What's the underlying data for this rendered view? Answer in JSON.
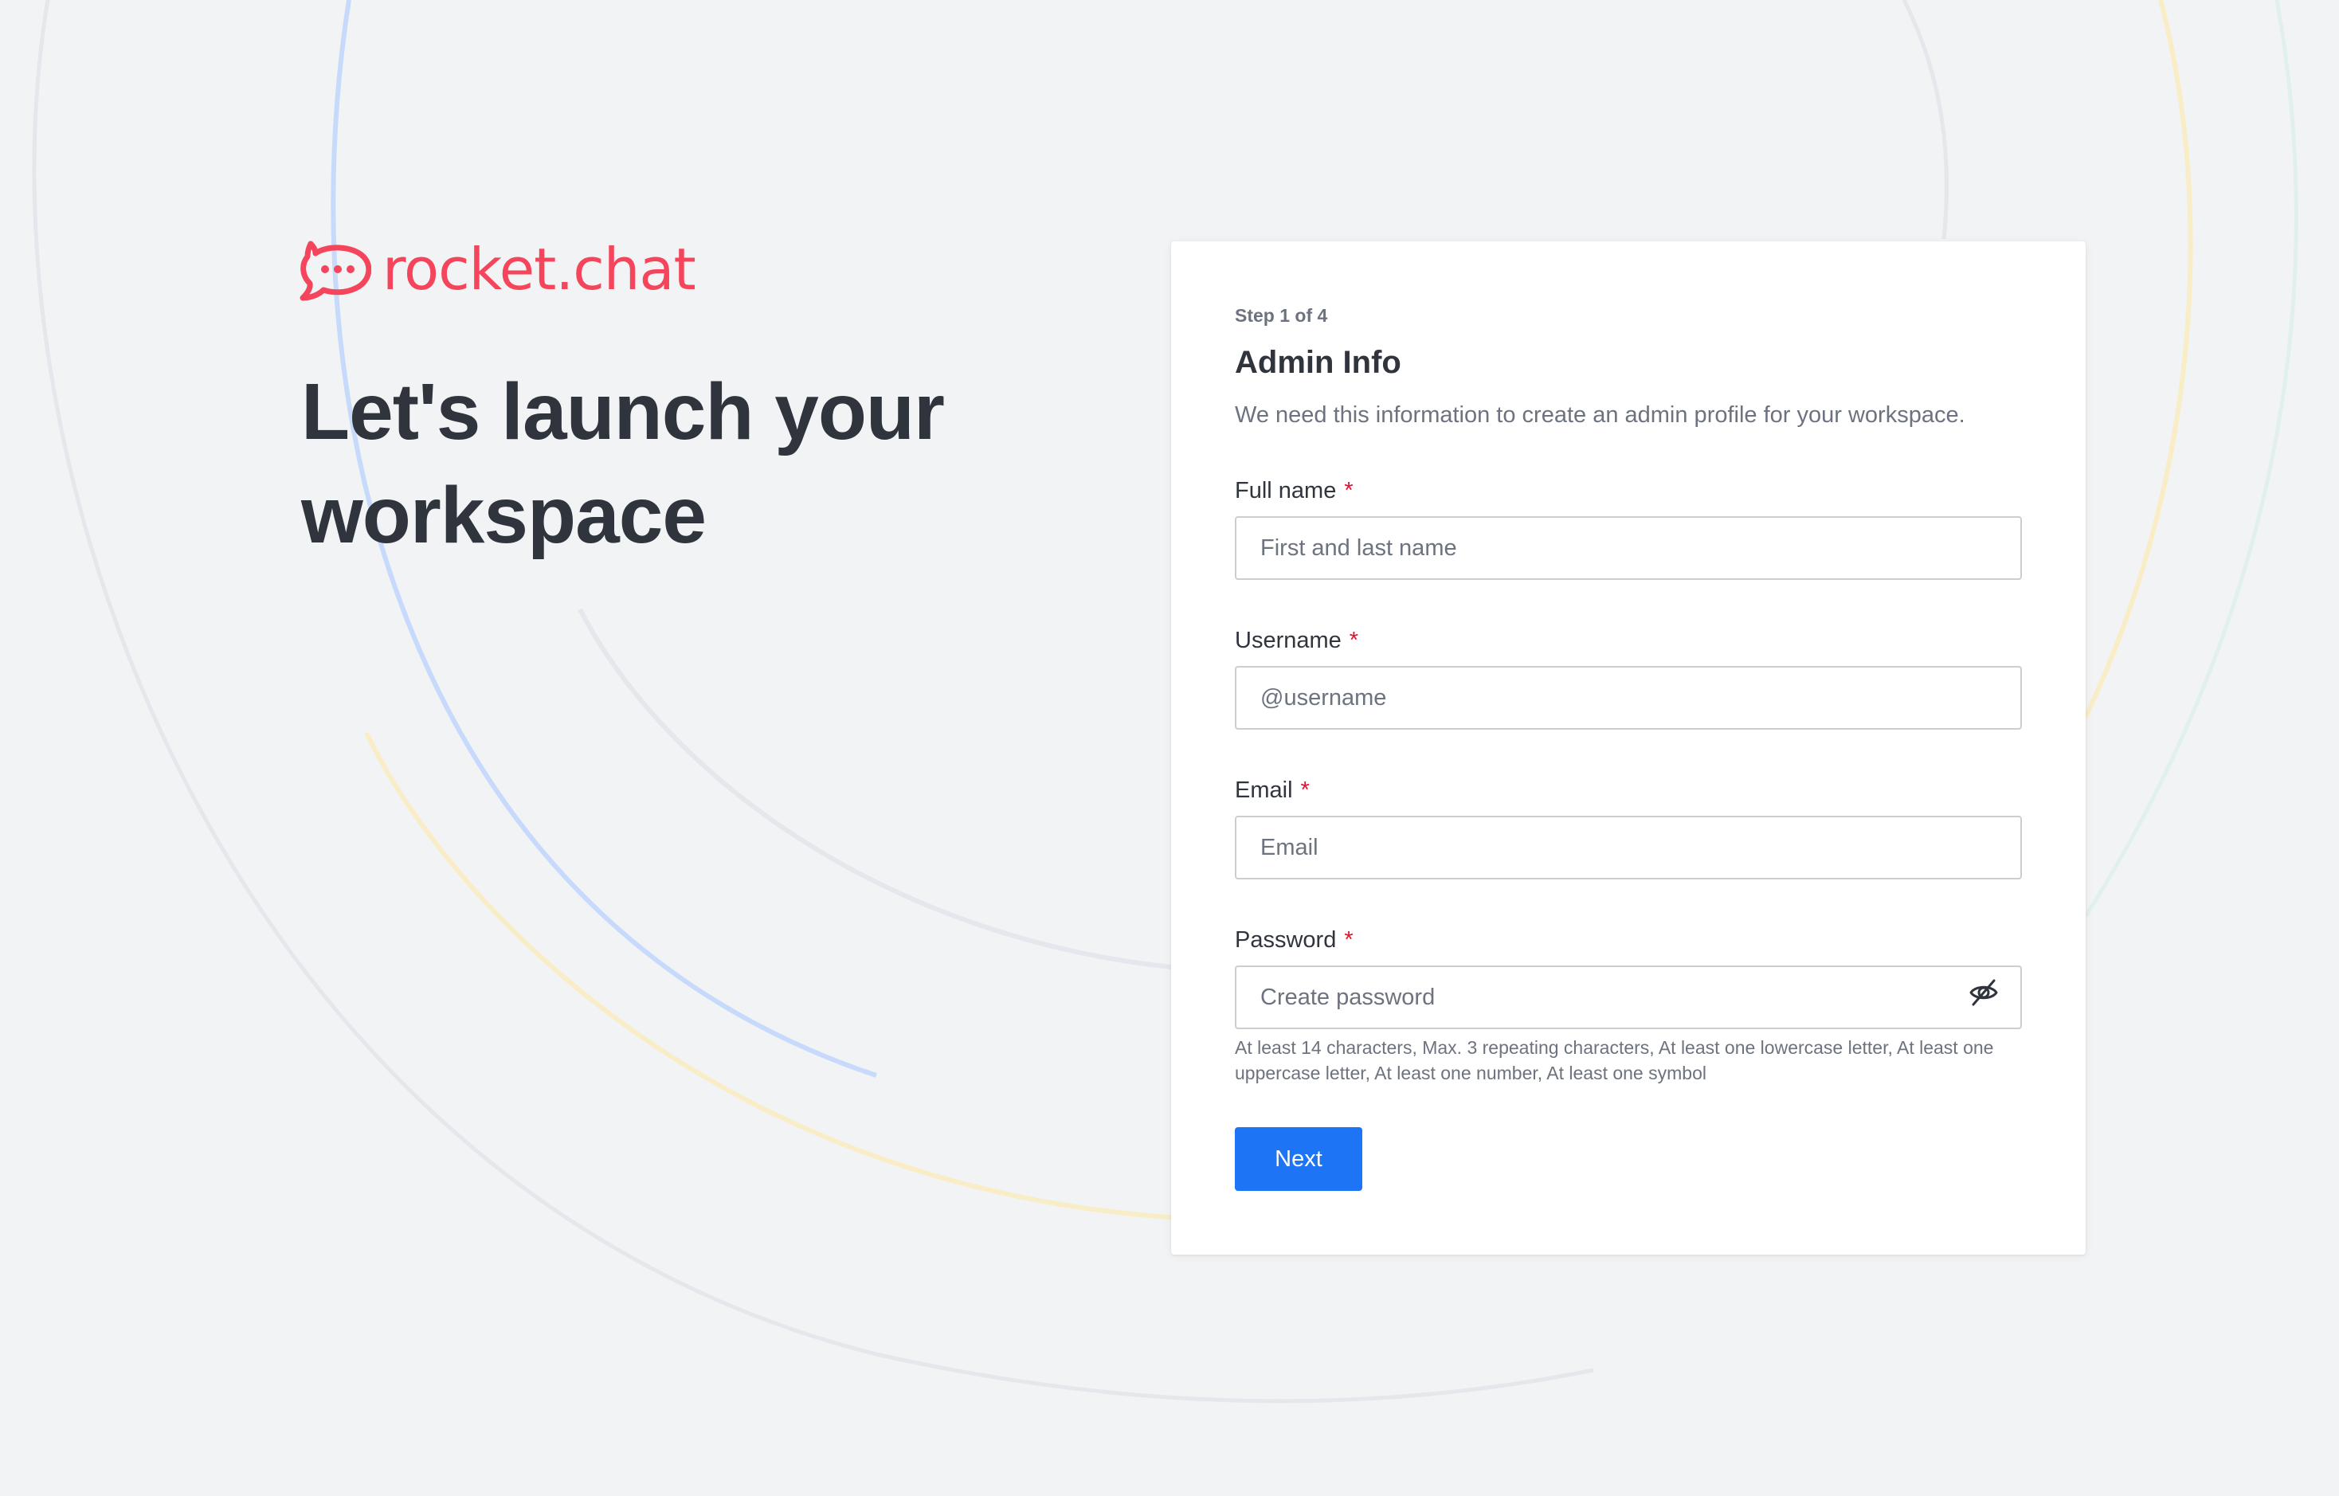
{
  "brand": {
    "logo_text": "rocket.chat",
    "color": "#f5455c"
  },
  "hero": {
    "title": "Let's launch your workspace"
  },
  "form": {
    "step": "Step 1 of 4",
    "title": "Admin Info",
    "description": "We need this information to create an admin profile for your workspace.",
    "required_marker": "*",
    "fields": [
      {
        "label": "Full name",
        "placeholder": "First and last name",
        "value": ""
      },
      {
        "label": "Username",
        "placeholder": "@username",
        "value": ""
      },
      {
        "label": "Email",
        "placeholder": "Email",
        "value": ""
      },
      {
        "label": "Password",
        "placeholder": "Create password",
        "value": ""
      }
    ],
    "password_icon": "eye-off-icon",
    "password_hint": "At least 14 characters, Max. 3 repeating characters, At least one lowercase letter, At least one uppercase letter, At least one number, At least one symbol",
    "next_label": "Next"
  },
  "colors": {
    "background": "#f2f3f5",
    "primary_button": "#1d74f5",
    "required": "#ec0d2a",
    "text": "#2f343d",
    "muted_text": "#6c737f"
  }
}
